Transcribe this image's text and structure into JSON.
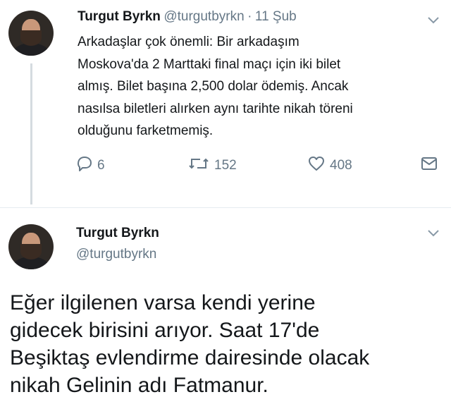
{
  "tweet1": {
    "name": "Turgut Byrkn",
    "handle": "@turgutbyrkn",
    "separator": "·",
    "date": "11 Şub",
    "text": "Arkadaşlar çok önemli: Bir arkadaşım\nMoskova'da 2 Marttaki final maçı için iki bilet\nalmış. Bilet başına 2,500 dolar ödemiş. Ancak\nnasılsa biletleri alırken aynı tarihte nikah töreni\nolduğunu farketmemiş.",
    "replies": "6",
    "retweets": "152",
    "likes": "408",
    "icons": [
      "reply-icon",
      "retweet-icon",
      "like-icon",
      "dm-icon",
      "chevron-down-icon"
    ]
  },
  "tweet2": {
    "name": "Turgut Byrkn",
    "handle": "@turgutbyrkn",
    "text": "Eğer ilgilenen varsa kendi yerine\ngidecek birisini arıyor. Saat 17'de\nBeşiktaş evlendirme dairesinde olacak\nnikah Gelinin adı Fatmanur."
  },
  "colors": {
    "text": "#14171a",
    "secondary": "#657786",
    "divider": "#e6ecf0",
    "thread": "#d5dbe0"
  }
}
